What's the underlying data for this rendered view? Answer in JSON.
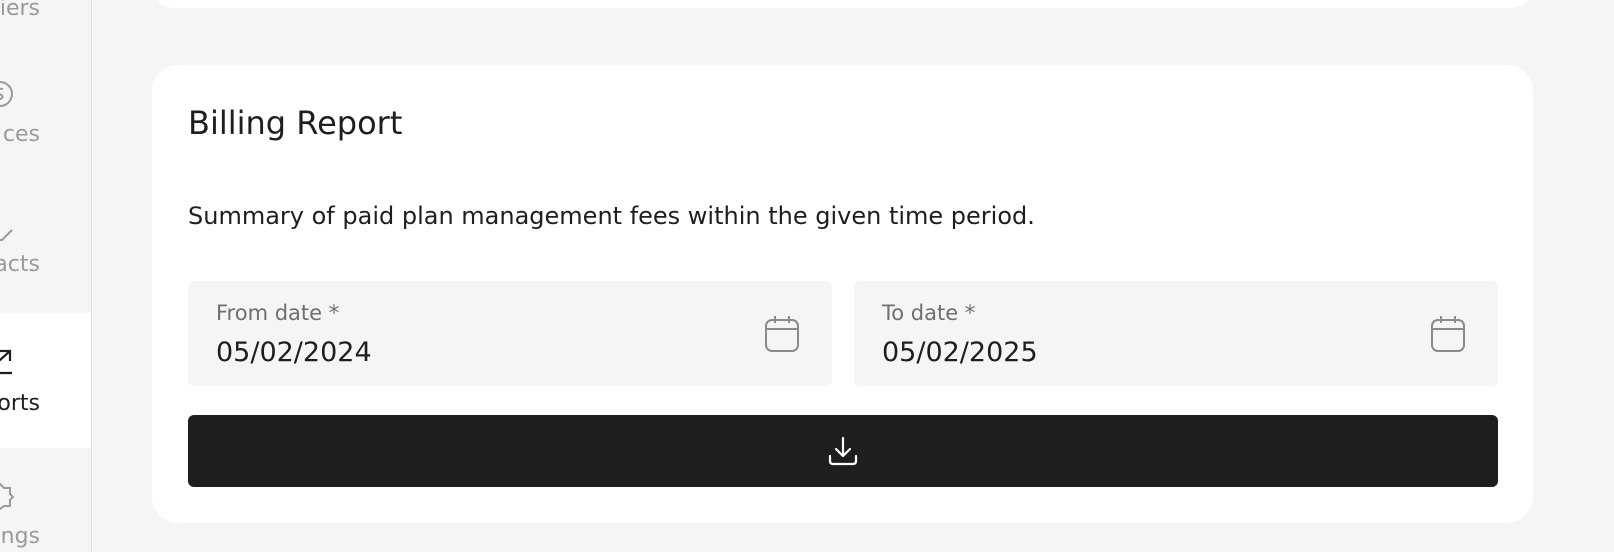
{
  "sidebar": {
    "items": [
      {
        "label": "liers",
        "icon": "suppliers-icon"
      },
      {
        "label": "ces",
        "icon": "invoices-icon"
      },
      {
        "label": "acts",
        "icon": "contacts-icon"
      },
      {
        "label": "orts",
        "icon": "reports-icon",
        "active": true
      },
      {
        "label": "ngs",
        "icon": "settings-icon"
      }
    ]
  },
  "billing": {
    "title": "Billing Report",
    "description": "Summary of paid plan management fees within the given time period.",
    "from_date": {
      "label": "From date *",
      "value": "05/02/2024",
      "icon": "calendar-icon"
    },
    "to_date": {
      "label": "To date *",
      "value": "05/02/2025",
      "icon": "calendar-icon"
    },
    "download_icon": "download-icon"
  },
  "colors": {
    "background": "#f5f5f5",
    "card": "#ffffff",
    "button": "#1e1e1e",
    "text": "#1e1e1e",
    "muted": "#9a9a9a"
  }
}
